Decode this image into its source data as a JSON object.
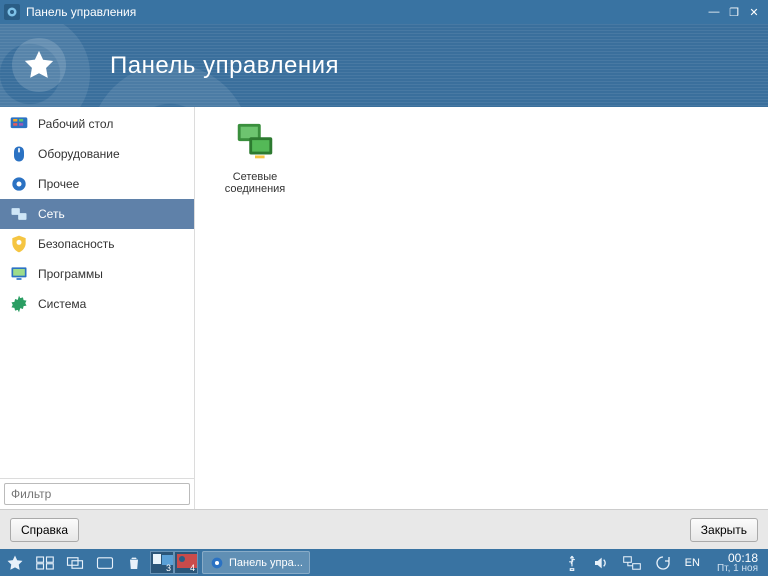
{
  "window": {
    "title": "Панель управления"
  },
  "banner": {
    "heading": "Панель управления"
  },
  "sidebar": {
    "items": [
      {
        "label": "Рабочий стол",
        "icon": "desktop"
      },
      {
        "label": "Оборудование",
        "icon": "mouse"
      },
      {
        "label": "Прочее",
        "icon": "gear"
      },
      {
        "label": "Сеть",
        "icon": "network",
        "selected": true
      },
      {
        "label": "Безопасность",
        "icon": "shield"
      },
      {
        "label": "Программы",
        "icon": "monitor"
      },
      {
        "label": "Система",
        "icon": "cog"
      }
    ],
    "filter_placeholder": "Фильтр"
  },
  "main": {
    "items": [
      {
        "label1": "Сетевые",
        "label2": "соединения"
      }
    ]
  },
  "footer": {
    "help_label": "Справка",
    "close_label": "Закрыть"
  },
  "taskbar": {
    "task_label": "Панель упра...",
    "pager": {
      "left_num": "3",
      "right_num": "4"
    },
    "lang": "EN",
    "clock_time": "00:18",
    "clock_date": "Пт, 1 ноя"
  }
}
